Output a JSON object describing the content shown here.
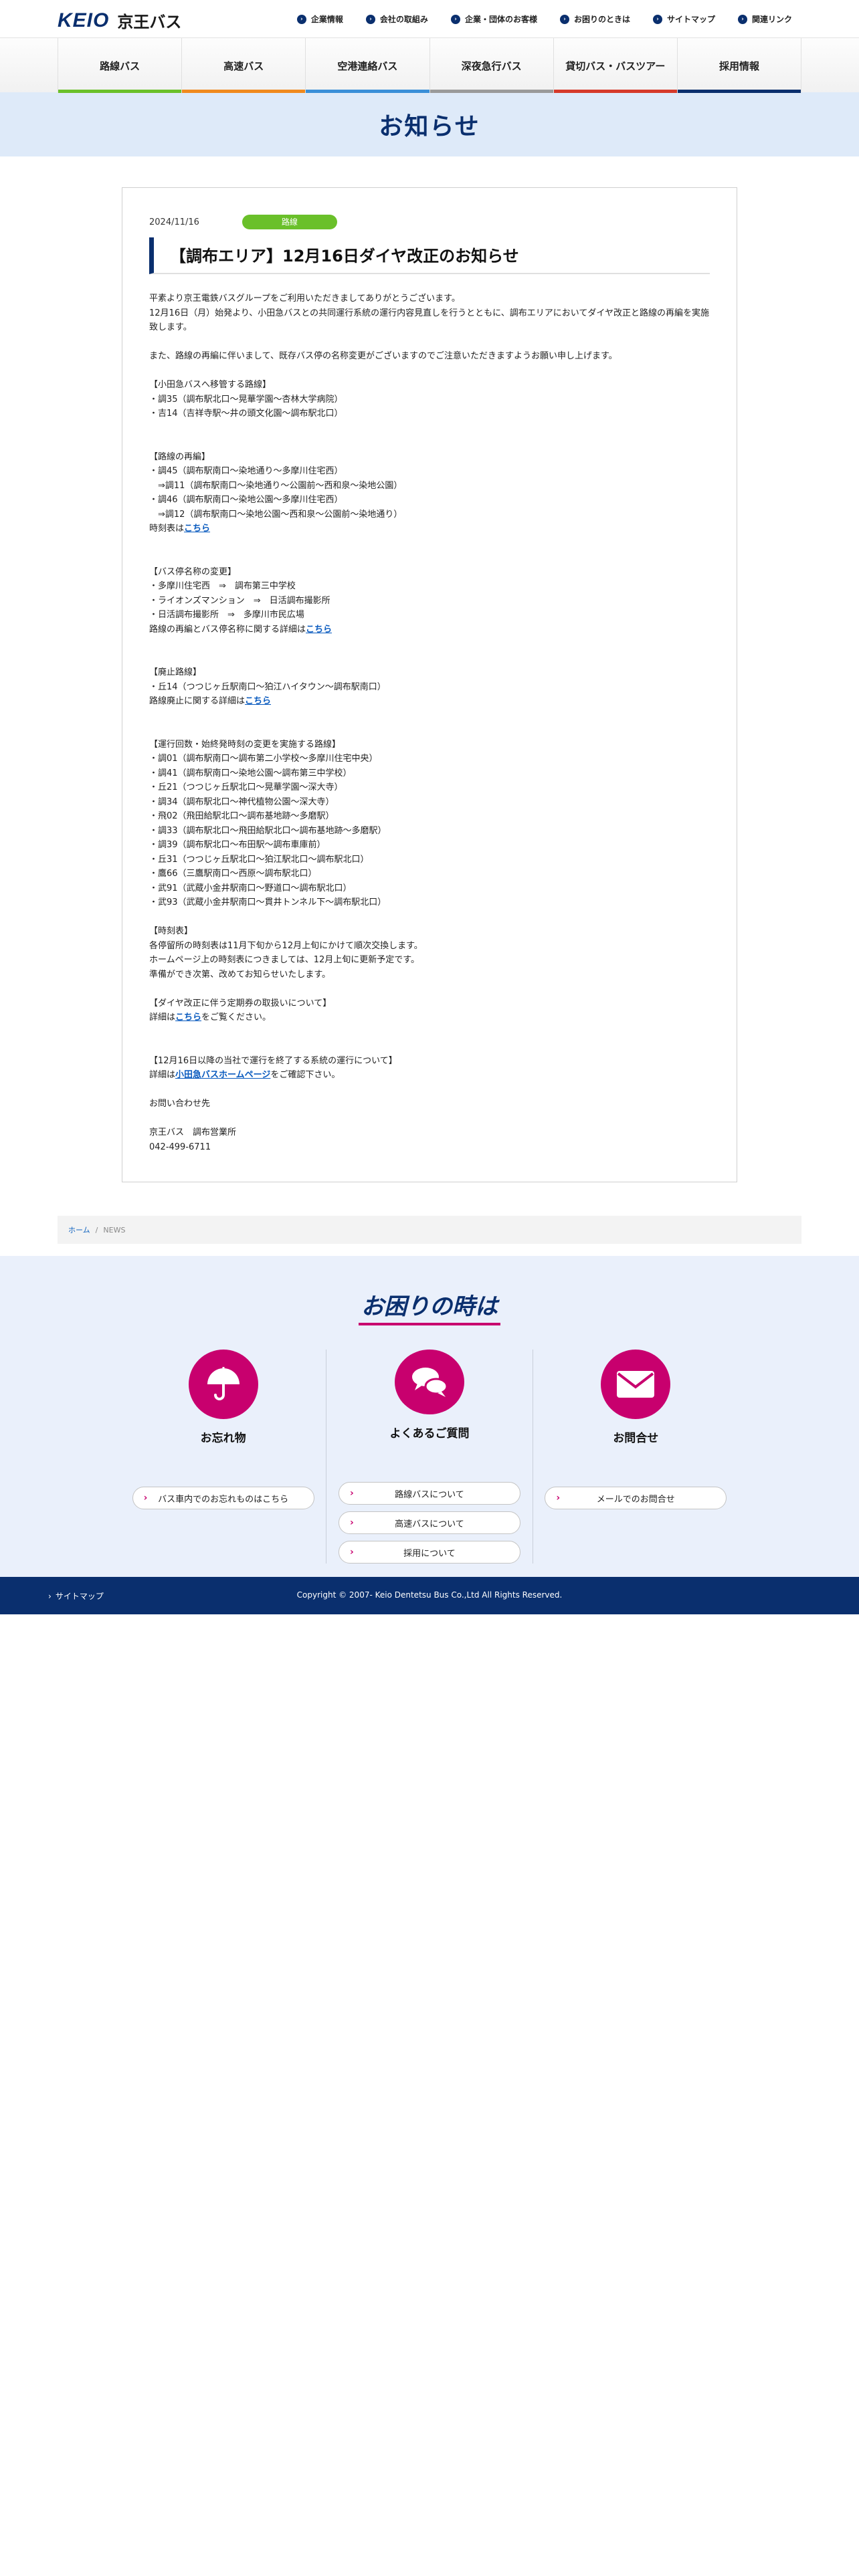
{
  "header": {
    "logo_en": "KEIO",
    "logo_jp": "京王バス",
    "top_links": [
      "企業情報",
      "会社の取組み",
      "企業・団体のお客様",
      "お困りのときは",
      "サイトマップ",
      "関連リンク"
    ]
  },
  "gnav": [
    {
      "label": "路線バス",
      "color": "#6ac02a"
    },
    {
      "label": "高速バス",
      "color": "#f08a1f"
    },
    {
      "label": "空港連絡バス",
      "color": "#3a8fd8"
    },
    {
      "label": "深夜急行バス",
      "color": "#9a9a9a"
    },
    {
      "label": "貸切バス・バスツアー",
      "color": "#d53a2b"
    },
    {
      "label": "採用情報",
      "color": "#0a2f6e"
    }
  ],
  "page_title": "お知らせ",
  "article": {
    "date": "2024/11/16",
    "category": "路線",
    "title": "【調布エリア】12月16日ダイヤ改正のお知らせ",
    "intro": "平素より京王電鉄バスグループをご利用いただきましてありがとうございます。\n12月16日（月）始発より、小田急バスとの共同運行系統の運行内容見直しを行うとともに、調布エリアにおいてダイヤ改正と路線の再編を実施致します。",
    "intro2": "また、路線の再編に伴いまして、既存バス停の名称変更がございますのでご注意いただきますようお願い申し上げます。",
    "sec1": "【小田急バスへ移管する路線】\n・調35（調布駅北口〜晃華学園〜杏林大学病院）\n・吉14（吉祥寺駅〜井の頭文化園〜調布駅北口）",
    "sec2": "【路線の再編】\n・調45（調布駅南口〜染地通り〜多摩川住宅西）\n　⇒調11（調布駅南口〜染地通り〜公園前〜西和泉〜染地公園）\n・調46（調布駅南口〜染地公園〜多摩川住宅西）\n　⇒調12（調布駅南口〜染地公園〜西和泉〜公園前〜染地通り）",
    "sec2_link_prefix": "時刻表は",
    "sec3": "【バス停名称の変更】\n・多摩川住宅西　⇒　調布第三中学校\n・ライオンズマンション　⇒　日活調布撮影所\n・日活調布撮影所　⇒　多摩川市民広場",
    "sec3_link_prefix": "路線の再編とバス停名称に関する詳細は",
    "sec4": "【廃止路線】\n・丘14（つつじヶ丘駅南口〜狛江ハイタウン〜調布駅南口）",
    "sec4_link_prefix": "路線廃止に関する詳細は",
    "sec5": "【運行回数・始終発時刻の変更を実施する路線】\n・調01（調布駅南口〜調布第二小学校〜多摩川住宅中央）\n・調41（調布駅南口〜染地公園〜調布第三中学校）\n・丘21（つつじヶ丘駅北口〜晃華学園〜深大寺）\n・調34（調布駅北口〜神代植物公園〜深大寺）\n・飛02（飛田給駅北口〜調布基地跡〜多磨駅）\n・調33（調布駅北口〜飛田給駅北口〜調布基地跡〜多磨駅）\n・調39（調布駅北口〜布田駅〜調布車庫前）\n・丘31（つつじヶ丘駅北口〜狛江駅北口〜調布駅北口）\n・鷹66（三鷹駅南口〜西原〜調布駅北口）\n・武91（武蔵小金井駅南口〜野道口〜調布駅北口）\n・武93（武蔵小金井駅南口〜貫井トンネル下〜調布駅北口）",
    "sec6": "【時刻表】\n各停留所の時刻表は11月下旬から12月上旬にかけて順次交換します。\nホームページ上の時刻表につきましては、12月上旬に更新予定です。\n準備ができ次第、改めてお知らせいたします。",
    "sec7": "【ダイヤ改正に伴う定期券の取扱いについて】",
    "sec7_link_prefix": "詳細は",
    "sec7_link_suffix": "をご覧ください。",
    "sec8": "【12月16日以降の当社で運行を終了する系統の運行について】",
    "sec8_link_prefix": "詳細は",
    "sec8_link": "小田急バスホームページ",
    "sec8_link_suffix": "をご確認下さい。",
    "contact": "お問い合わせ先",
    "contact_detail": "京王バス　調布営業所\n042-499-6711",
    "link_kochira": "こちら"
  },
  "breadcrumb": {
    "home": "ホーム",
    "sep": "/",
    "current": "NEWS"
  },
  "help": {
    "title": "お困りの時は",
    "accent": "#c8006e",
    "columns": [
      {
        "icon": "umbrella-icon",
        "title": "お忘れ物",
        "links": [
          "バス車内でのお忘れものはこちら"
        ]
      },
      {
        "icon": "chat-bubbles-icon",
        "title": "よくあるご質問",
        "links": [
          "路線バスについて",
          "高速バスについて",
          "採用について"
        ]
      },
      {
        "icon": "envelope-icon",
        "title": "お問合せ",
        "links": [
          "メールでのお問合せ"
        ]
      }
    ]
  },
  "footer": {
    "sitemap": "サイトマップ",
    "copyright": "Copyright © 2007- Keio Dentetsu Bus Co.,Ltd All Rights Reserved."
  }
}
